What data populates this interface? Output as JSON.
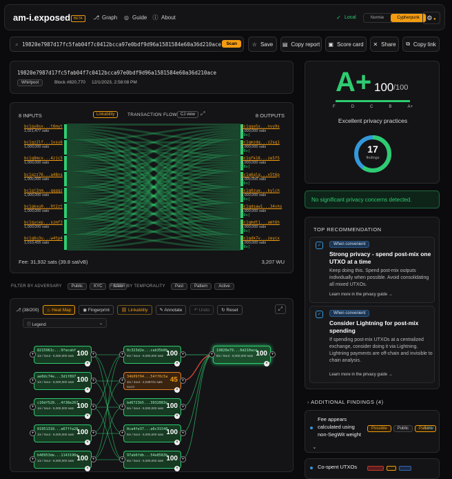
{
  "header": {
    "logo": "am-i.exposed",
    "beta": "BETA",
    "nav": [
      {
        "icon": "graph-icon",
        "label": "Graph"
      },
      {
        "icon": "guide-icon",
        "label": "Guide"
      },
      {
        "icon": "info-icon",
        "label": "About"
      }
    ],
    "network": "Local",
    "theme_normie": "Normie",
    "theme_cypher": "Cypherpunk"
  },
  "search": {
    "value": "19820e7987d17fc5fab04f7c0412bcca97e0bdf9d96a1581584e60a36d210ace",
    "scan": "Scan"
  },
  "toolbar": {
    "save": "Save",
    "copy_report": "Copy report",
    "score_card": "Score card",
    "share": "Share",
    "copy_link": "Copy link"
  },
  "tx": {
    "txid": "19820e7987d17fc5fab04f7c0412bcca97e0bdf9d96a1581584e60a36d210ace",
    "type": "Whirlpool",
    "block": "Block #820,770",
    "date": "12/1/2023, 2:58:08 PM"
  },
  "score": {
    "grade": "A+",
    "value": "100",
    "max": "/100",
    "scale": [
      "F",
      "D",
      "C",
      "B",
      "A+"
    ],
    "summary": "Excellent privacy practices",
    "findings_count": "17",
    "findings_label": "findings"
  },
  "alert": {
    "text": "No significant privacy concerns detected."
  },
  "flow": {
    "inputs_label": "8 INPUTS",
    "outputs_label": "8 OUTPUTS",
    "linkability": "Linkability",
    "title": "TRANSACTION FLOW",
    "cj_view": "CJ view",
    "fee": "Fee: 31,932 sats (39.8 sat/vB)",
    "weight": "3,207 WU",
    "inputs": [
      {
        "addr": "bc1qy8sx...t6myt",
        "sats": "1,021,477 sats"
      },
      {
        "addr": "bc1qz2lf...1xsu6",
        "sats": "1,000,000 sats"
      },
      {
        "addr": "bc1q8mcx...4zjc5",
        "sats": "1,000,000 sats"
      },
      {
        "addr": "bc1qzz76...a48ns",
        "sats": "1,000,000 sats"
      },
      {
        "addr": "bc1qj2nm...qqgqz",
        "sats": "1,000,000 sats"
      },
      {
        "addr": "bc1qkxu0...9t2zt",
        "sats": "1,000,000 sats"
      },
      {
        "addr": "bc1qycep...szmf3",
        "sats": "1,000,000 sats"
      },
      {
        "addr": "bc1q6u3u...w4tp4",
        "sats": "1,010,455 sats"
      }
    ],
    "outputs": [
      {
        "addr": "bc1qqe5x...nvy9s",
        "sats": "1,000,000 sats",
        "tag": "[8x]"
      },
      {
        "addr": "bc1qmzdg...z2sg1",
        "sats": "1,000,000 sats",
        "tag": "[8x]"
      },
      {
        "addr": "bc1qfk16...ze5f5",
        "sats": "1,000,000 sats",
        "tag": "[8x]"
      },
      {
        "addr": "bc1q6qlq...x5t6p",
        "sats": "1,000,000 sats",
        "tag": "[8x]"
      },
      {
        "addr": "bc1q0zue...kylch",
        "sats": "1,000,000 sats",
        "tag": "[8x]"
      },
      {
        "addr": "bc1qdsaw1...34vhs",
        "sats": "1,000,000 sats",
        "tag": "[8x]"
      },
      {
        "addr": "bc1qmdt1...amt6h",
        "sats": "1,000,000 sats",
        "tag": "[8x]"
      },
      {
        "addr": "bc1qdk7v...zeycx",
        "sats": "1,000,000 sats",
        "tag": "[8x]"
      }
    ]
  },
  "filters": {
    "adversary_label": "FILTER BY ADVERSARY",
    "adversary": [
      "Public",
      "KYC",
      "State"
    ],
    "temporality_label": "FILTER BY TEMPORALITY",
    "temporality": [
      "Past",
      "Pattern",
      "Active"
    ]
  },
  "graph": {
    "count": "(38/200)",
    "heatmap": "Heat Map",
    "fingerprint": "Fingerprint",
    "linkability": "Linkability",
    "annotate": "Annotate",
    "undo": "Undo",
    "reset": "Reset",
    "legend": "Legend",
    "col1": [
      {
        "id": "8215961c...9facabf",
        "meta": "1in / 5out - 5,000,000 sats",
        "score": "100"
      },
      {
        "id": "ae0dc74e...3d1f897",
        "meta": "1in / 5out - 8,000,000 sats",
        "score": "100"
      },
      {
        "id": "c10df528...4f38e267",
        "meta": "1in / 5out - 5,000,000 sats",
        "score": "100"
      },
      {
        "id": "01951318...a67ffa28",
        "meta": "1in / 5out - 8,000,000 sats",
        "score": "100"
      },
      {
        "id": "b40953de...1143190a",
        "meta": "1in / 5out - 8,000,000 sats",
        "score": "100"
      }
    ],
    "col2": [
      {
        "id": "0c323d2e...cab35b0b",
        "meta": "5in / 5out - 8,000,000 sats",
        "score": "100"
      },
      {
        "id": "34b09f94...54ff0c5a",
        "meta": "1in / 4out - 2,048721 sats",
        "score": "45",
        "sub": "Batch"
      },
      {
        "id": "bd6723b5...3932883c",
        "meta": "5in / 5out - 8,000,000 sats",
        "score": "100"
      },
      {
        "id": "0ca4fe37...a6c31540",
        "meta": "5in / 5out - 5,000,000 sats",
        "score": "100"
      },
      {
        "id": "97ab6fdb...54e8583b",
        "meta": "5in / 5out - 5,000,000 sats",
        "score": "100"
      }
    ],
    "center": {
      "id": "19820e79...6d210ace",
      "meta": "8in / 8out - 8,000,000 sats",
      "score": "100"
    }
  },
  "recommendation": {
    "header": "TOP RECOMMENDATION",
    "items": [
      {
        "badge": "When convenient",
        "title": "Strong privacy - spend post-mix one UTXO at a time",
        "body": "Keep doing this. Spend post-mix outputs individually when possible. Avoid consolidating all mixed UTXOs.",
        "link": "Learn more in the privacy guide →"
      },
      {
        "badge": "When convenient",
        "title": "Consider Lightning for post-mix spending",
        "body": "If spending post-mix UTXOs at a centralized exchange, consider doing it via Lightning. Lightning payments are off-chain and invisible to chain analysis.",
        "link": "Learn more in the privacy guide →"
      }
    ]
  },
  "additional": {
    "header": "ADDITIONAL FINDINGS (4)",
    "items": [
      {
        "title": "Fee appears calculated using non-SegWit weight",
        "tags": [
          "Possible",
          "Public",
          "Pattern"
        ],
        "severity": "Low"
      },
      {
        "title": "Co-spent UTXOs"
      }
    ]
  },
  "colors": {
    "accent": "#f39c12",
    "good": "#2ecc71",
    "blue": "#3498db",
    "bg": "#0b0b0d"
  }
}
